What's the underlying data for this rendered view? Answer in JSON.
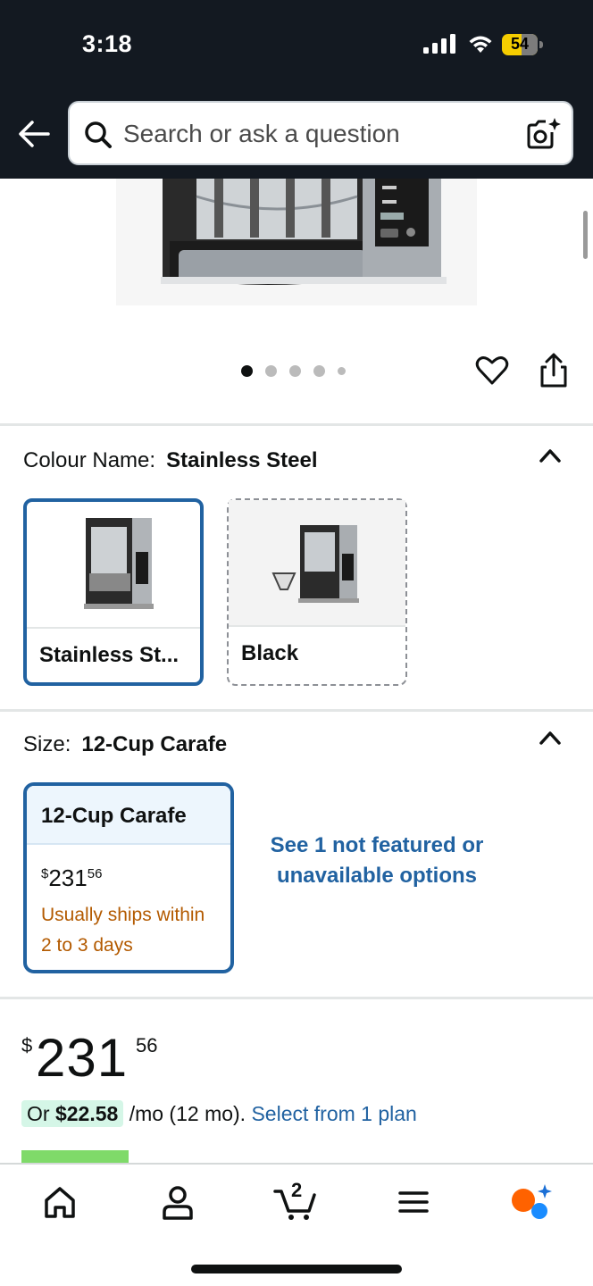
{
  "status_bar": {
    "time": "3:18",
    "battery_level": "54"
  },
  "header": {
    "search_placeholder": "Search or ask a question"
  },
  "gallery": {
    "image_count": 5,
    "active_index": 0
  },
  "colour": {
    "label": "Colour Name:",
    "selected": "Stainless Steel",
    "options": [
      {
        "name": "Stainless St...",
        "selected": true,
        "available": true
      },
      {
        "name": "Black",
        "selected": false,
        "available": false
      }
    ]
  },
  "size": {
    "label": "Size:",
    "selected": "12-Cup Carafe",
    "option": {
      "name": "12-Cup Carafe",
      "price_currency": "$",
      "price_whole": "231",
      "price_fraction": "56",
      "shipping": "Usually ships within 2 to 3 days"
    },
    "not_featured_link": "See 1 not featured or unavailable options"
  },
  "price": {
    "currency": "$",
    "whole": "231",
    "fraction": "56"
  },
  "installment": {
    "prefix": "Or",
    "amount": "$22.58",
    "term": "/mo (12 mo).",
    "link": "Select from 1 plan"
  },
  "bottom_nav": {
    "items": [
      "home",
      "account",
      "cart",
      "menu",
      "rufus"
    ],
    "cart_count": "2"
  },
  "colors": {
    "header_bg": "#131921",
    "link": "#2162a1",
    "selected_border": "#2162a1",
    "shipping_text": "#b35a00",
    "installment_bg": "#d5f6e7",
    "battery": "#f5cd00"
  }
}
